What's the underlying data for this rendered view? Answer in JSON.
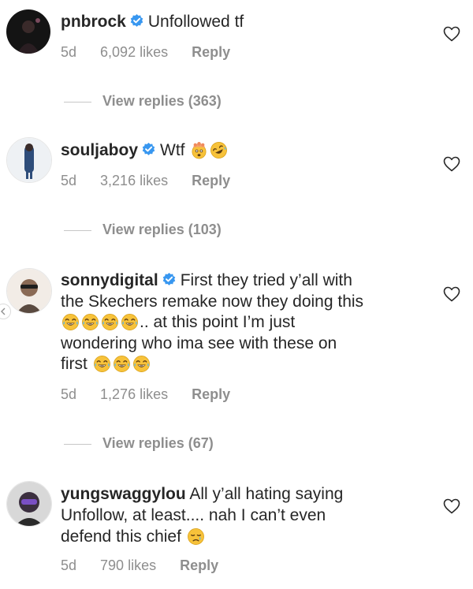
{
  "comments": [
    {
      "username": "pnbrock",
      "text": "Unfollowed tf",
      "age": "5d",
      "likes": "6,092 likes",
      "reply_label": "Reply",
      "view_replies": "View replies (363)",
      "emojis": []
    },
    {
      "username": "souljaboy",
      "text": "Wtf",
      "age": "5d",
      "likes": "3,216 likes",
      "reply_label": "Reply",
      "view_replies": "View replies (103)",
      "emojis": [
        "exploding-head-emoji",
        "rofl-emoji"
      ]
    },
    {
      "username": "sonnydigital",
      "text_line1": "First they tried y’all with",
      "text_line2": "the Skechers remake now they doing this",
      "text_line3_after": ".. at this point I’m just",
      "text_line4": "wondering who ima see with these on",
      "text_line5": "first",
      "age": "5d",
      "likes": "1,276 likes",
      "reply_label": "Reply",
      "view_replies": "View replies (67)",
      "emojis": [
        "joy-emoji",
        "joy-emoji",
        "joy-emoji",
        "joy-emoji",
        "joy-emoji",
        "joy-emoji",
        "joy-emoji"
      ]
    },
    {
      "username": "yungswaggylou",
      "text_line1": "All y’all hating saying",
      "text_line2": "Unfollow, at least.... nah I can’t even",
      "text_line3": "defend this chief",
      "age": "5d",
      "likes": "790 likes",
      "reply_label": "Reply",
      "emojis": [
        "sad-face-emoji"
      ]
    }
  ],
  "colors": {
    "verified_blue": "#3897f0",
    "secondary_text": "#8e8e8e",
    "primary_text": "#262626",
    "emoji_yellow": "#f7c23a"
  },
  "icons": {
    "like": "heart-outline-icon",
    "verified": "verified-badge-icon"
  }
}
